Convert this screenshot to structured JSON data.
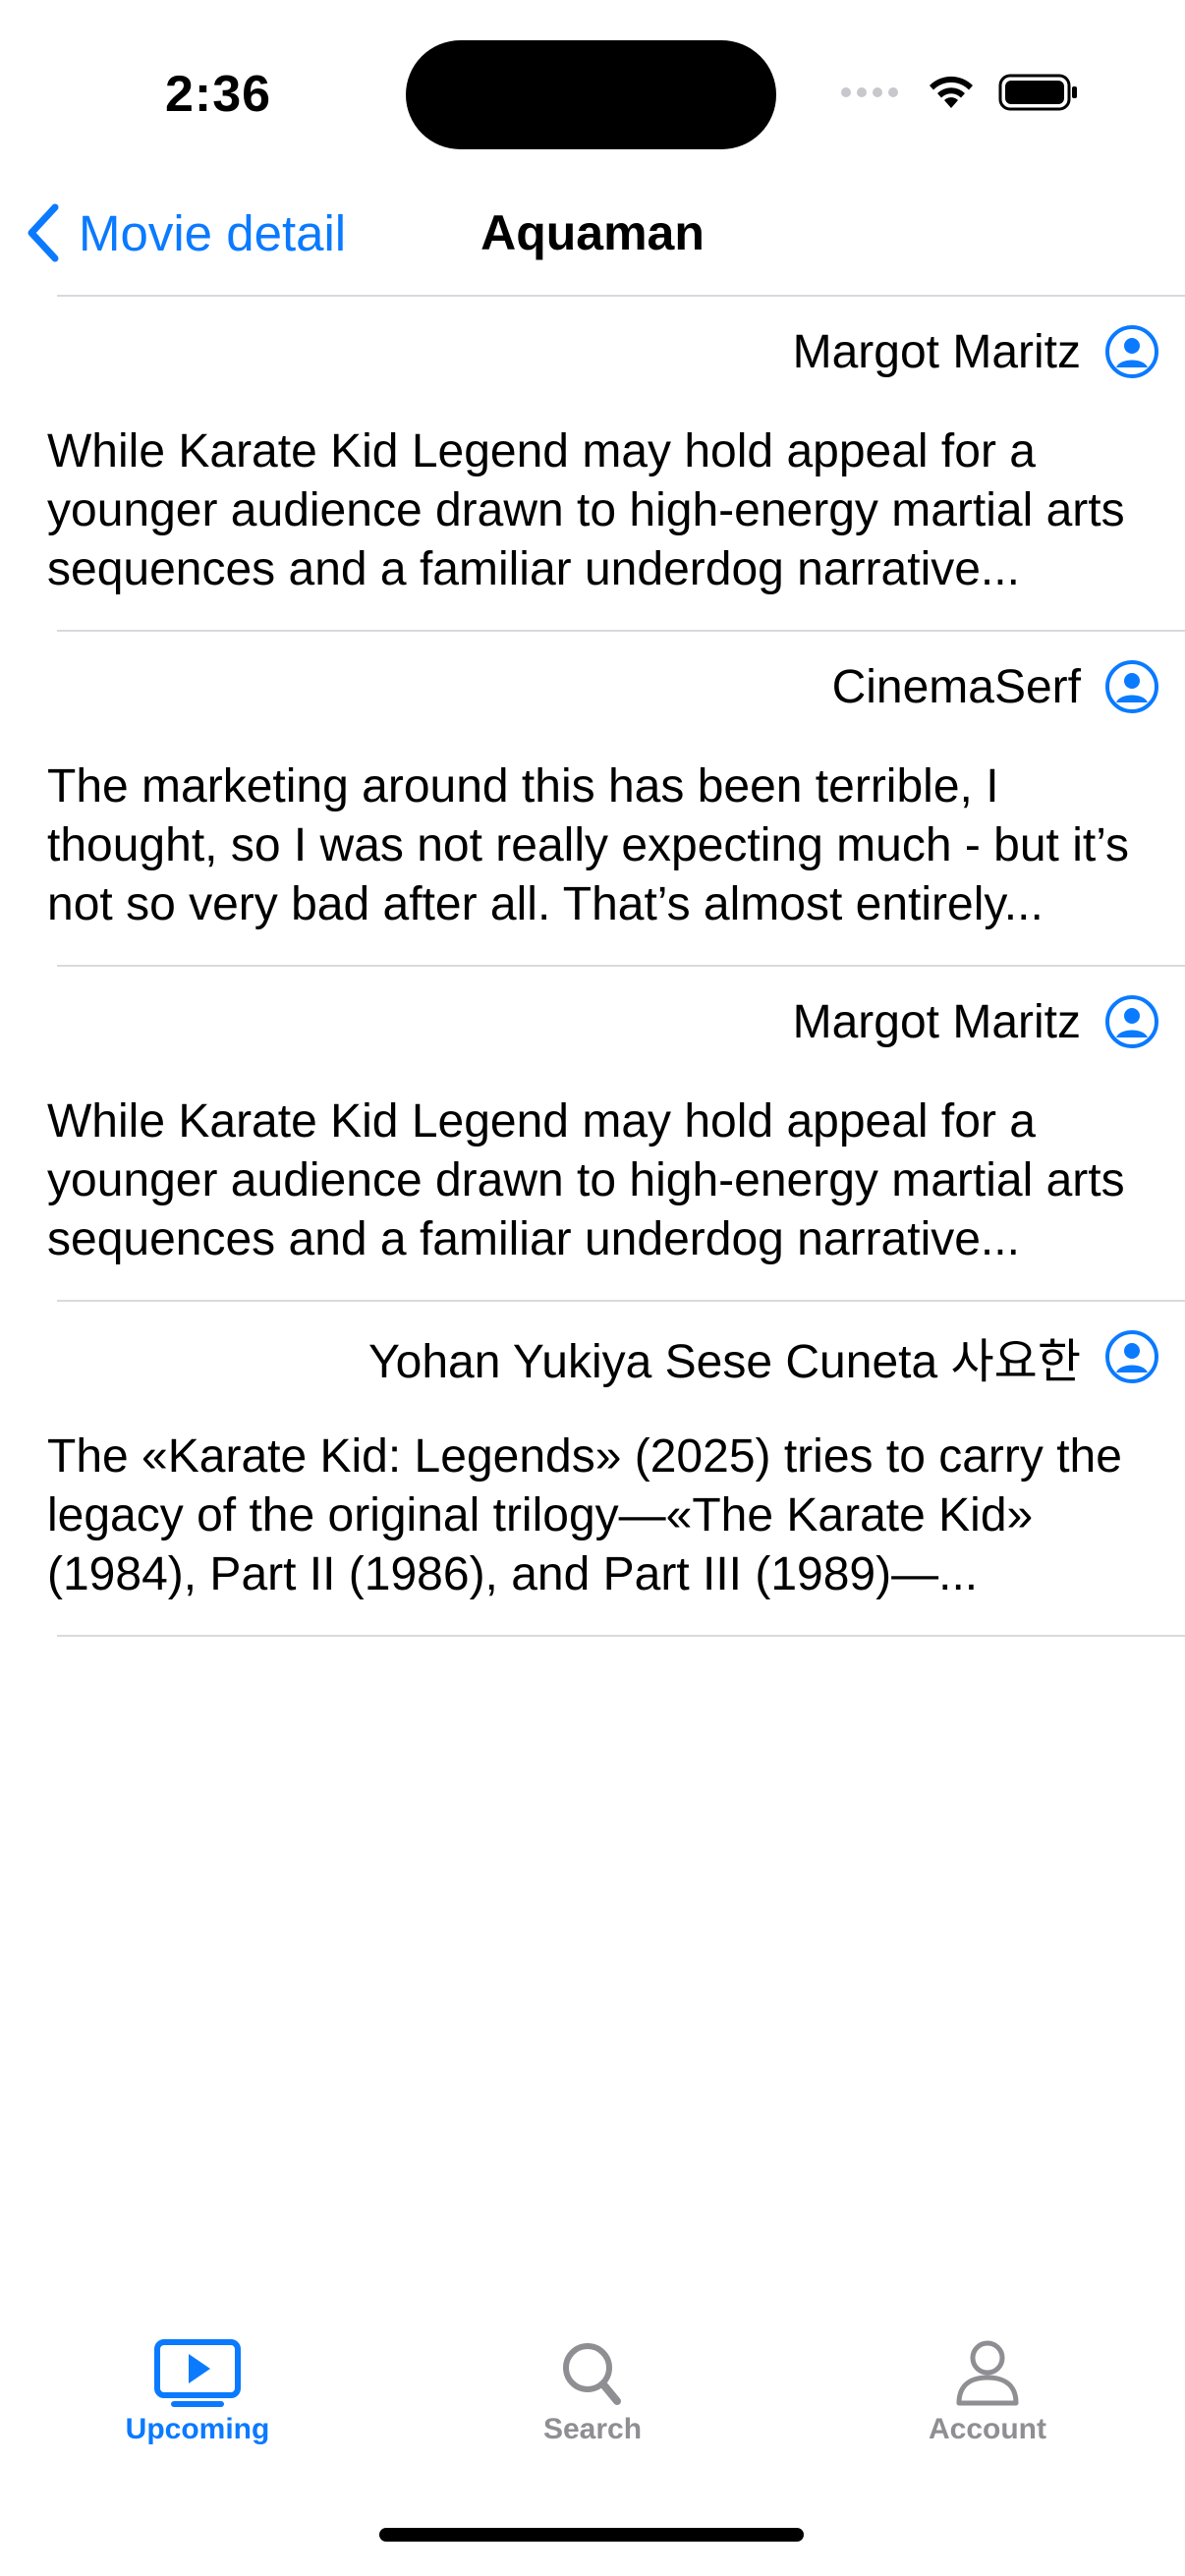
{
  "status_bar": {
    "time": "2:36"
  },
  "nav": {
    "back_label": "Movie detail",
    "title": "Aquaman"
  },
  "reviews": [
    {
      "author": "Margot Maritz",
      "text": "While Karate Kid Legend may hold appeal for a younger audience drawn to high-energy martial arts sequences and a familiar underdog narrative..."
    },
    {
      "author": "CinemaSerf",
      "text": "The marketing around this has been terrible, I thought, so I was not really expecting much - but it’s not so very bad after all. That’s almost entirely..."
    },
    {
      "author": "Margot Maritz",
      "text": "While Karate Kid Legend may hold appeal for a younger audience drawn to high-energy martial arts sequences and a familiar underdog narrative..."
    },
    {
      "author": "Yohan Yukiya Sese Cuneta 사요한",
      "text": "The «Karate Kid: Legends» (2025) tries to carry the legacy of the original trilogy—«The Karate Kid» (1984), Part II (1986), and Part III (1989)—..."
    }
  ],
  "tab_bar": {
    "tabs": [
      {
        "label": "Upcoming",
        "icon": "play-rectangle-icon",
        "active": true
      },
      {
        "label": "Search",
        "icon": "magnifying-glass-icon",
        "active": false
      },
      {
        "label": "Account",
        "icon": "person-icon",
        "active": false
      }
    ]
  },
  "colors": {
    "accent": "#0a7aff",
    "inactive": "#8e8e93",
    "divider": "#d9d9de"
  }
}
